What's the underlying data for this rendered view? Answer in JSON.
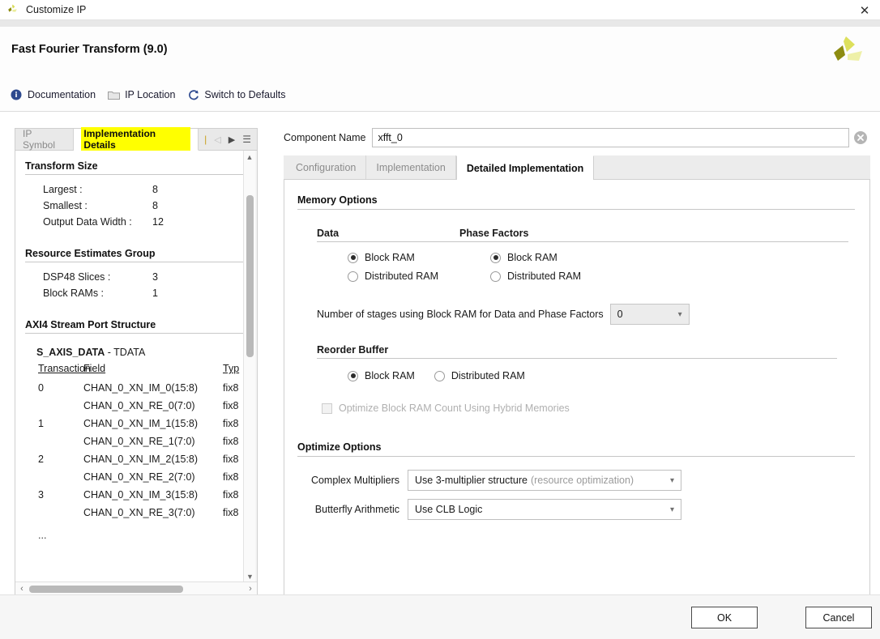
{
  "window": {
    "title": "Customize IP",
    "close_label": "✕",
    "app_icon": "vivado-logo-icon"
  },
  "header": {
    "ip_title": "Fast Fourier Transform (9.0)",
    "vendor_logo": "xilinx-logo-icon",
    "toolbar": [
      {
        "label": "Documentation",
        "icon": "info-icon",
        "name": "documentation-link"
      },
      {
        "label": "IP Location",
        "icon": "folder-icon",
        "name": "ip-location-link"
      },
      {
        "label": "Switch to Defaults",
        "icon": "refresh-icon",
        "name": "switch-to-defaults-link"
      }
    ]
  },
  "left_panel": {
    "tabs": [
      {
        "label": "IP Symbol",
        "active": false
      },
      {
        "label": "Implementation Details",
        "active": true,
        "highlighted": true
      }
    ],
    "tab_nav": [
      {
        "name": "tab-divider-icon",
        "glyph": "|"
      },
      {
        "name": "prev-arrow-icon",
        "glyph": "◁"
      },
      {
        "name": "next-arrow-icon",
        "glyph": "▶"
      },
      {
        "name": "tab-menu-icon",
        "glyph": "☰"
      }
    ],
    "sections": {
      "transform_size": {
        "heading": "Transform Size",
        "rows": [
          {
            "key": "Largest :",
            "value": "8"
          },
          {
            "key": "Smallest :",
            "value": "8"
          },
          {
            "key": "Output Data Width :",
            "value": "12"
          }
        ]
      },
      "resource_estimates": {
        "heading": "Resource Estimates Group",
        "rows": [
          {
            "key": "DSP48 Slices :",
            "value": "3"
          },
          {
            "key": "Block RAMs :",
            "value": "1"
          }
        ]
      },
      "axi4_stream": {
        "heading": "AXI4 Stream Port Structure",
        "sub_heading_bold": "S_AXIS_DATA",
        "sub_heading_rest": " - TDATA",
        "columns": [
          "Transaction",
          "Field",
          "Typ"
        ],
        "rows": [
          {
            "transaction": "0",
            "field": "CHAN_0_XN_IM_0(15:8)",
            "type": "fix8"
          },
          {
            "transaction": "",
            "field": "CHAN_0_XN_RE_0(7:0)",
            "type": "fix8"
          },
          {
            "transaction": "1",
            "field": "CHAN_0_XN_IM_1(15:8)",
            "type": "fix8"
          },
          {
            "transaction": "",
            "field": "CHAN_0_XN_RE_1(7:0)",
            "type": "fix8"
          },
          {
            "transaction": "2",
            "field": "CHAN_0_XN_IM_2(15:8)",
            "type": "fix8"
          },
          {
            "transaction": "",
            "field": "CHAN_0_XN_RE_2(7:0)",
            "type": "fix8"
          },
          {
            "transaction": "3",
            "field": "CHAN_0_XN_IM_3(15:8)",
            "type": "fix8"
          },
          {
            "transaction": "",
            "field": "CHAN_0_XN_RE_3(7:0)",
            "type": "fix8"
          }
        ],
        "ellipsis": "..."
      }
    }
  },
  "right_panel": {
    "component_name": {
      "label": "Component Name",
      "value": "xfft_0",
      "placeholder": "Component Name",
      "clear_icon": "clear-circle-icon"
    },
    "tabs": [
      {
        "label": "Configuration",
        "active": false
      },
      {
        "label": "Implementation",
        "active": false
      },
      {
        "label": "Detailed Implementation",
        "active": true
      }
    ],
    "memory_options": {
      "heading": "Memory Options",
      "data": {
        "title": "Data",
        "options": [
          {
            "label": "Block RAM",
            "selected": true
          },
          {
            "label": "Distributed RAM",
            "selected": false
          }
        ]
      },
      "phase_factors": {
        "title": "Phase Factors",
        "options": [
          {
            "label": "Block RAM",
            "selected": true
          },
          {
            "label": "Distributed RAM",
            "selected": false
          }
        ]
      },
      "stages": {
        "label": "Number of stages using Block RAM for Data and Phase Factors",
        "value": "0"
      },
      "reorder_buffer": {
        "title": "Reorder Buffer",
        "options": [
          {
            "label": "Block RAM",
            "selected": true
          },
          {
            "label": "Distributed RAM",
            "selected": false
          }
        ]
      },
      "hybrid_checkbox": {
        "label": "Optimize Block RAM Count Using Hybrid Memories",
        "checked": false,
        "disabled": true
      }
    },
    "optimize_options": {
      "heading": "Optimize Options",
      "complex_multipliers": {
        "label": "Complex Multipliers",
        "value": "Use 3-multiplier structure",
        "value_muted": "(resource optimization)"
      },
      "butterfly_arithmetic": {
        "label": "Butterfly Arithmetic",
        "value": "Use CLB Logic",
        "value_muted": ""
      }
    }
  },
  "footer": {
    "ok_label": "OK",
    "cancel_label": "Cancel"
  },
  "colors": {
    "accent_blue": "#2e4a8f",
    "highlight_yellow": "#ffff00",
    "vendor_green": "#cfd04e"
  }
}
